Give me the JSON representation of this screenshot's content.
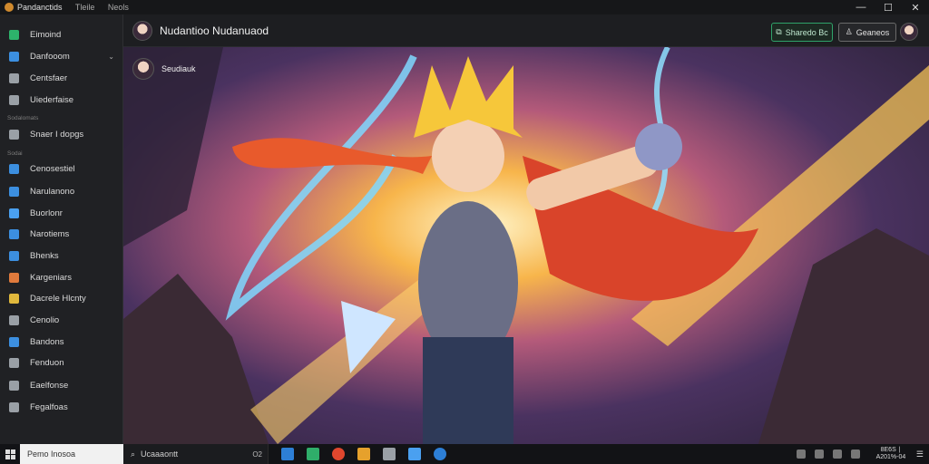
{
  "titlebar": {
    "menu": [
      "Pandanctids",
      "Tleile",
      "Neols"
    ],
    "controls": [
      "—",
      "☐",
      "✕"
    ]
  },
  "sidebar": {
    "items": [
      {
        "label": "Eimoind",
        "icon": "home-icon",
        "color": "#2db36b",
        "y": 0
      },
      {
        "label": "Danfooom",
        "icon": "folder-icon",
        "color": "#3c8fe0",
        "y": 1,
        "chevron": "⌄"
      },
      {
        "label": "Centsfaer",
        "icon": "gear-icon",
        "color": "#9aa0a6",
        "y": 2
      },
      {
        "label": "Uiederfaise",
        "icon": "settings-icon",
        "color": "#9aa0a6",
        "y": 3
      },
      {
        "label": "Snaer I dopgs",
        "icon": "doc-icon",
        "color": "#9aa0a6",
        "y": 4
      },
      {
        "label": "Cenosestiel",
        "icon": "channel-icon",
        "color": "#3c8fe0",
        "y": 5
      },
      {
        "label": "Narulanono",
        "icon": "list-icon",
        "color": "#3c8fe0",
        "y": 6
      },
      {
        "label": "Buorlonr",
        "icon": "stack-icon",
        "color": "#4aa0f0",
        "y": 7
      },
      {
        "label": "Narotiems",
        "icon": "box-icon",
        "color": "#3c8fe0",
        "y": 8
      },
      {
        "label": "Bhenks",
        "icon": "pin-icon",
        "color": "#3c8fe0",
        "y": 9
      },
      {
        "label": "Kargeniars",
        "icon": "palette-icon",
        "color": "#e07a3c",
        "y": 10
      },
      {
        "label": "Dacrele Hlcnty",
        "icon": "image-icon",
        "color": "#e0b83c",
        "y": 11
      },
      {
        "label": "Cenolio",
        "icon": "book-icon",
        "color": "#9aa0a6",
        "y": 12
      },
      {
        "label": "Bandons",
        "icon": "calendar-icon",
        "color": "#3c8fe0",
        "y": 13
      },
      {
        "label": "Fenduon",
        "icon": "user-icon",
        "color": "#9aa0a6",
        "y": 14
      },
      {
        "label": "Eaelfonse",
        "icon": "flag-icon",
        "color": "#9aa0a6",
        "y": 15
      },
      {
        "label": "Fegalfoas",
        "icon": "bell-icon",
        "color": "#9aa0a6",
        "y": 16
      }
    ],
    "section_label_1": "Sodalomats",
    "section_label_2": "Sodai"
  },
  "header": {
    "title": "Nudantioo Nudanuaod",
    "share_label": "Sharedo Bc",
    "account_label": "Geaneos"
  },
  "canvas": {
    "channel_name": "Seudiauk"
  },
  "taskbar": {
    "search_white": "Pemo Inosoa",
    "search_dark": "Ucaaaontt",
    "search_num": "O2",
    "clock_line1": "8E6S ∣",
    "clock_line2": "A201%-04",
    "notif": "☰"
  }
}
